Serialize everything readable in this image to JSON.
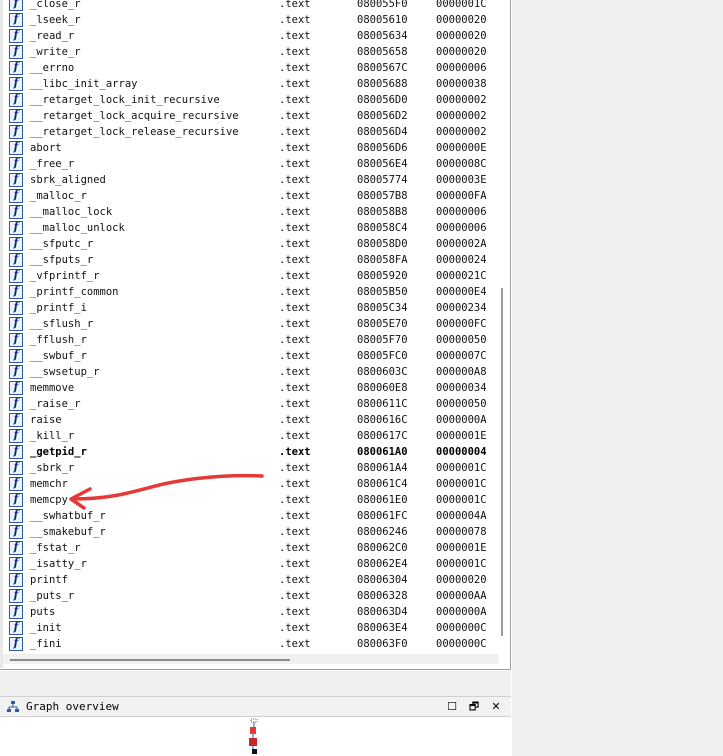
{
  "functions": [
    {
      "name": "_close_r",
      "segment": ".text",
      "start": "080055F0",
      "length": "0000001C"
    },
    {
      "name": "_lseek_r",
      "segment": ".text",
      "start": "08005610",
      "length": "00000020"
    },
    {
      "name": "_read_r",
      "segment": ".text",
      "start": "08005634",
      "length": "00000020"
    },
    {
      "name": "_write_r",
      "segment": ".text",
      "start": "08005658",
      "length": "00000020"
    },
    {
      "name": "__errno",
      "segment": ".text",
      "start": "0800567C",
      "length": "00000006"
    },
    {
      "name": "__libc_init_array",
      "segment": ".text",
      "start": "08005688",
      "length": "00000038"
    },
    {
      "name": "__retarget_lock_init_recursive",
      "segment": ".text",
      "start": "080056D0",
      "length": "00000002"
    },
    {
      "name": "__retarget_lock_acquire_recursive",
      "segment": ".text",
      "start": "080056D2",
      "length": "00000002"
    },
    {
      "name": "__retarget_lock_release_recursive",
      "segment": ".text",
      "start": "080056D4",
      "length": "00000002"
    },
    {
      "name": "abort",
      "segment": ".text",
      "start": "080056D6",
      "length": "0000000E"
    },
    {
      "name": "_free_r",
      "segment": ".text",
      "start": "080056E4",
      "length": "0000008C"
    },
    {
      "name": "sbrk_aligned",
      "segment": ".text",
      "start": "08005774",
      "length": "0000003E"
    },
    {
      "name": "_malloc_r",
      "segment": ".text",
      "start": "080057B8",
      "length": "000000FA"
    },
    {
      "name": "__malloc_lock",
      "segment": ".text",
      "start": "080058B8",
      "length": "00000006"
    },
    {
      "name": "__malloc_unlock",
      "segment": ".text",
      "start": "080058C4",
      "length": "00000006"
    },
    {
      "name": "__sfputc_r",
      "segment": ".text",
      "start": "080058D0",
      "length": "0000002A"
    },
    {
      "name": "__sfputs_r",
      "segment": ".text",
      "start": "080058FA",
      "length": "00000024"
    },
    {
      "name": "_vfprintf_r",
      "segment": ".text",
      "start": "08005920",
      "length": "0000021C"
    },
    {
      "name": "_printf_common",
      "segment": ".text",
      "start": "08005B50",
      "length": "000000E4"
    },
    {
      "name": "_printf_i",
      "segment": ".text",
      "start": "08005C34",
      "length": "00000234"
    },
    {
      "name": "__sflush_r",
      "segment": ".text",
      "start": "08005E70",
      "length": "000000FC"
    },
    {
      "name": "_fflush_r",
      "segment": ".text",
      "start": "08005F70",
      "length": "00000050"
    },
    {
      "name": "__swbuf_r",
      "segment": ".text",
      "start": "08005FC0",
      "length": "0000007C"
    },
    {
      "name": "__swsetup_r",
      "segment": ".text",
      "start": "0800603C",
      "length": "000000A8"
    },
    {
      "name": "memmove",
      "segment": ".text",
      "start": "080060E8",
      "length": "00000034"
    },
    {
      "name": "_raise_r",
      "segment": ".text",
      "start": "0800611C",
      "length": "00000050"
    },
    {
      "name": "raise",
      "segment": ".text",
      "start": "0800616C",
      "length": "0000000A"
    },
    {
      "name": "_kill_r",
      "segment": ".text",
      "start": "0800617C",
      "length": "0000001E"
    },
    {
      "name": "_getpid_r",
      "segment": ".text",
      "start": "080061A0",
      "length": "00000004",
      "bold": true
    },
    {
      "name": "_sbrk_r",
      "segment": ".text",
      "start": "080061A4",
      "length": "0000001C"
    },
    {
      "name": "memchr",
      "segment": ".text",
      "start": "080061C4",
      "length": "0000001C"
    },
    {
      "name": "memcpy",
      "segment": ".text",
      "start": "080061E0",
      "length": "0000001C"
    },
    {
      "name": "__swhatbuf_r",
      "segment": ".text",
      "start": "080061FC",
      "length": "0000004A"
    },
    {
      "name": "__smakebuf_r",
      "segment": ".text",
      "start": "08006246",
      "length": "00000078"
    },
    {
      "name": "_fstat_r",
      "segment": ".text",
      "start": "080062C0",
      "length": "0000001E"
    },
    {
      "name": "_isatty_r",
      "segment": ".text",
      "start": "080062E4",
      "length": "0000001C"
    },
    {
      "name": "printf",
      "segment": ".text",
      "start": "08006304",
      "length": "00000020"
    },
    {
      "name": "_puts_r",
      "segment": ".text",
      "start": "08006328",
      "length": "000000AA"
    },
    {
      "name": "puts",
      "segment": ".text",
      "start": "080063D4",
      "length": "0000000A"
    },
    {
      "name": "_init",
      "segment": ".text",
      "start": "080063E4",
      "length": "0000000C"
    },
    {
      "name": "_fini",
      "segment": ".text",
      "start": "080063F0",
      "length": "0000000C"
    }
  ],
  "function_icon": "function-f-icon",
  "function_icon_glyph": "f",
  "graph_overview": {
    "title": "Graph overview",
    "icon": "graph-icon",
    "buttons": {
      "maximize": "☐",
      "restore": "🗗",
      "close": "✕"
    }
  },
  "annotation": {
    "color": "#e53935",
    "points_to": "memcpy"
  },
  "colors": {
    "icon_border": "#2a5aa8",
    "icon_fill": "#eaf2fc",
    "panel_bg": "#f0f0f0"
  }
}
